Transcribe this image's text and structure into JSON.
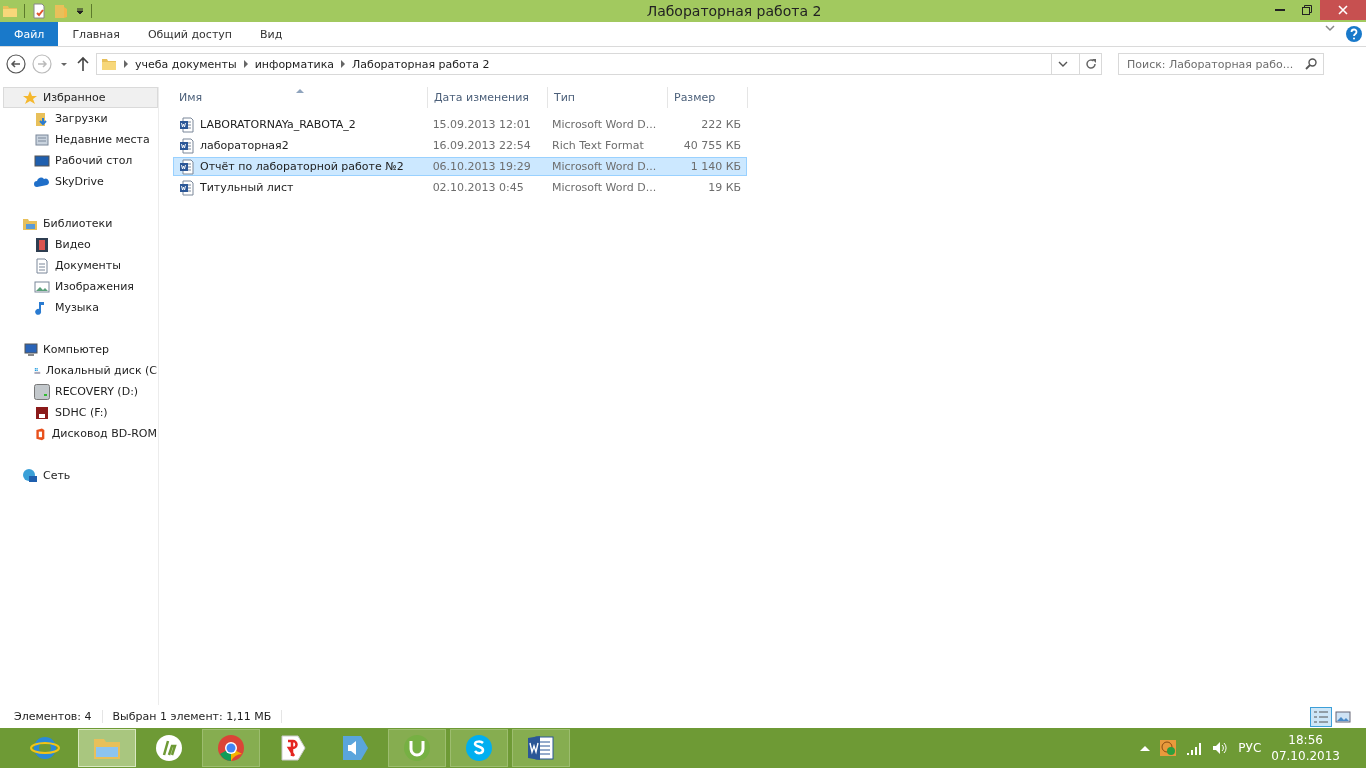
{
  "window": {
    "title": "Лабораторная работа 2"
  },
  "ribbon_tabs": [
    {
      "label": "Файл",
      "selected": true
    },
    {
      "label": "Главная",
      "selected": false
    },
    {
      "label": "Общий доступ",
      "selected": false
    },
    {
      "label": "Вид",
      "selected": false
    }
  ],
  "address": {
    "breadcrumbs": [
      "учеба документы",
      "информатика",
      "Лабораторная работа 2"
    ]
  },
  "search": {
    "placeholder": "Поиск: Лабораторная рабо..."
  },
  "sidebar": {
    "items": [
      {
        "label": "Избранное",
        "selected": true,
        "children": [
          {
            "label": "Загрузки",
            "selected": false
          },
          {
            "label": "Недавние места",
            "selected": false
          },
          {
            "label": "Рабочий стол",
            "selected": false
          },
          {
            "label": "SkyDrive",
            "selected": false
          }
        ]
      },
      {
        "label": "Библиотеки",
        "selected": false,
        "children": [
          {
            "label": "Видео",
            "selected": false
          },
          {
            "label": "Документы",
            "selected": false
          },
          {
            "label": "Изображения",
            "selected": false
          },
          {
            "label": "Музыка",
            "selected": false
          }
        ]
      },
      {
        "label": "Компьютер",
        "selected": false,
        "children": [
          {
            "label": "Локальный диск (С",
            "selected": false
          },
          {
            "label": "RECOVERY (D:)",
            "selected": false
          },
          {
            "label": "SDHC (F:)",
            "selected": false
          },
          {
            "label": "Дисковод BD-ROM",
            "selected": false
          }
        ]
      },
      {
        "label": "Сеть",
        "selected": false
      }
    ]
  },
  "table": {
    "columns": [
      {
        "label": "Имя",
        "sorted": true
      },
      {
        "label": "Дата изменения",
        "sorted": false
      },
      {
        "label": "Тип",
        "sorted": false
      },
      {
        "label": "Размер",
        "sorted": false
      }
    ],
    "rows": [
      {
        "name": "LABORATORNAYa_RABOTA_2",
        "date": "15.09.2013 12:01",
        "type": "Microsoft Word D...",
        "size": "222 КБ",
        "selected": false
      },
      {
        "name": "лабораторная2",
        "date": "16.09.2013 22:54",
        "type": "Rich Text Format",
        "size": "40 755 КБ",
        "selected": false
      },
      {
        "name": "Отчёт по лабораторной работе №2",
        "date": "06.10.2013 19:29",
        "type": "Microsoft Word D...",
        "size": "1 140 КБ",
        "selected": true
      },
      {
        "name": "Титульный лист",
        "date": "02.10.2013 0:45",
        "type": "Microsoft Word D...",
        "size": "19 КБ",
        "selected": false
      }
    ]
  },
  "status_bar": {
    "count": "Элементов: 4",
    "selection": "Выбран 1 элемент: 1,11 МБ",
    "views": [
      {
        "selected": true
      },
      {
        "selected": false
      }
    ]
  },
  "taskbar": {
    "buttons": [
      {
        "running": false,
        "selected": false
      },
      {
        "running": true,
        "selected": true
      },
      {
        "running": false,
        "selected": false
      },
      {
        "running": true,
        "selected": false
      },
      {
        "running": false,
        "selected": false
      },
      {
        "running": false,
        "selected": false
      },
      {
        "running": true,
        "selected": false
      },
      {
        "running": true,
        "selected": false
      },
      {
        "running": true,
        "selected": false
      }
    ],
    "language": "РУС",
    "time": "18:56",
    "date": "07.10.2013"
  }
}
